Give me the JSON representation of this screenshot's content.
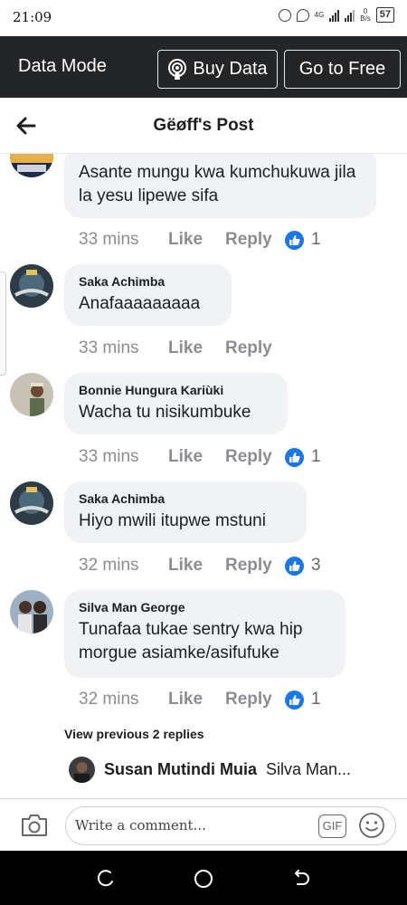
{
  "status_bar": {
    "time": "21:09",
    "net_label": "4G",
    "speed": "0",
    "speed_unit": "B/s",
    "battery": "57"
  },
  "data_mode": {
    "label": "Data Mode",
    "buy_data": "Buy Data",
    "go_free": "Go to Free"
  },
  "header": {
    "title": "Gëøff's Post"
  },
  "comments": [
    {
      "text": "Asante mungu kwa kumchukuwa jila la yesu lipewe sifa",
      "time": "33 mins",
      "like": "Like",
      "reply": "Reply",
      "reactions": "1"
    },
    {
      "name": "Saka Achimba",
      "text": "Anafaaaaaaaaa",
      "time": "33 mins",
      "like": "Like",
      "reply": "Reply"
    },
    {
      "name": "Bonnie Hungura Kariùki",
      "text": "Wacha tu nisikumbuke",
      "time": "33 mins",
      "like": "Like",
      "reply": "Reply",
      "reactions": "1"
    },
    {
      "name": "Saka Achimba",
      "text": "Hiyo mwili itupwe mstuni",
      "time": "32 mins",
      "like": "Like",
      "reply": "Reply",
      "reactions": "3"
    },
    {
      "name": "Silva Man George",
      "text": "Tunafaa tukae sentry kwa hip morgue asiamke/asifufuke",
      "time": "32 mins",
      "like": "Like",
      "reply": "Reply",
      "reactions": "1"
    }
  ],
  "replies": {
    "view_previous": "View previous 2 replies",
    "latest_name": "Susan Mutindi Muia",
    "latest_text": "Silva Man..."
  },
  "composer": {
    "placeholder": "Write a comment...",
    "gif": "GIF"
  },
  "colors": {
    "accent": "#1877f2",
    "bar_dark": "#242526",
    "bubble": "#f0f2f5",
    "meta": "#8a8d91"
  },
  "icons": [
    "back-arrow-icon",
    "podcast-icon",
    "like-thumb-icon",
    "camera-icon",
    "gif-icon",
    "emoji-icon",
    "recent-apps-icon",
    "home-icon",
    "back-icon"
  ]
}
